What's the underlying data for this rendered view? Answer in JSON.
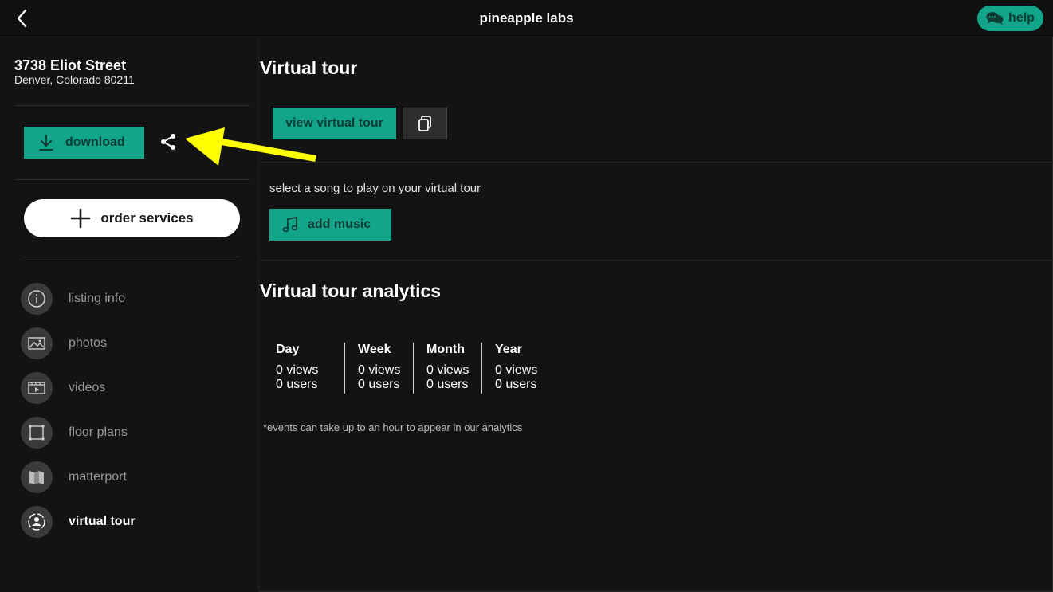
{
  "header": {
    "title": "pineapple labs",
    "help_label": "help"
  },
  "listing": {
    "street": "3738 Eliot Street",
    "city_line": "Denver, Colorado 80211"
  },
  "sidebar": {
    "download_label": "download",
    "order_label": "order services",
    "items": [
      {
        "label": "listing info",
        "icon": "info-icon"
      },
      {
        "label": "photos",
        "icon": "image-icon"
      },
      {
        "label": "videos",
        "icon": "video-icon"
      },
      {
        "label": "floor plans",
        "icon": "floor-plan-icon"
      },
      {
        "label": "matterport",
        "icon": "matterport-icon"
      },
      {
        "label": "virtual tour",
        "icon": "virtual-tour-icon",
        "active": true
      }
    ]
  },
  "main": {
    "virtual_tour_title": "Virtual tour",
    "view_tour_label": "view virtual tour",
    "music_caption": "select a song to play on your virtual tour",
    "add_music_label": "add music",
    "analytics_title": "Virtual tour analytics",
    "analytics": [
      {
        "period": "Day",
        "views": "0 views",
        "users": "0 users"
      },
      {
        "period": "Week",
        "views": "0 views",
        "users": "0 users"
      },
      {
        "period": "Month",
        "views": "0 views",
        "users": "0 users"
      },
      {
        "period": "Year",
        "views": "0 views",
        "users": "0 users"
      }
    ],
    "analytics_note": "*events can take up to an hour to appear in our analytics"
  },
  "colors": {
    "accent": "#12a58a",
    "background": "#131313",
    "annotation_arrow": "#ffff00"
  }
}
